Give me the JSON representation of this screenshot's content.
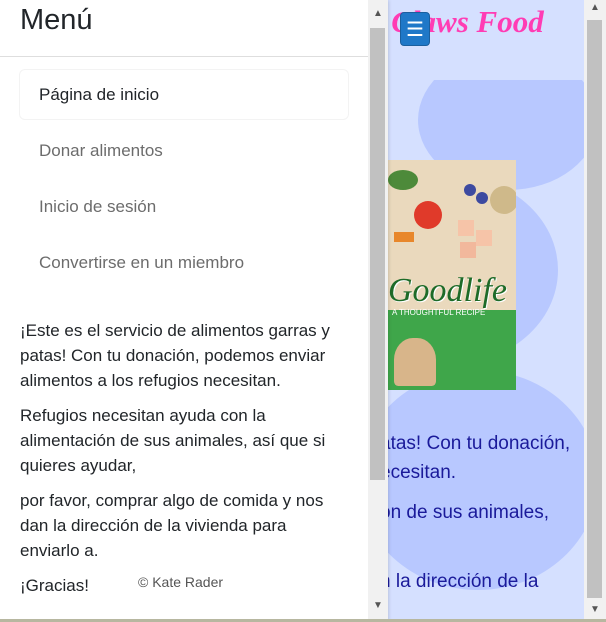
{
  "background_page": {
    "site_title": "d Claws Food",
    "toggle_icon": "☰",
    "product_logo": "Goodlife",
    "product_sub": "A THOUGHTFUL RECIPE",
    "text_lines": [
      "atas! Con tu donación,",
      "ecesitan.",
      "ón de sus animales,",
      "n la dirección de la"
    ],
    "colors": {
      "title": "#ff3cb4",
      "text": "#1a1a9a",
      "accent": "#1f78c8"
    }
  },
  "offcanvas": {
    "title": "Menú",
    "nav": [
      {
        "label": "Página de inicio",
        "active": true
      },
      {
        "label": "Donar alimentos",
        "active": false
      },
      {
        "label": "Inicio de sesión",
        "active": false
      },
      {
        "label": "Convertirse en un miembro",
        "active": false
      }
    ],
    "paragraphs": [
      "¡Este es el servicio de alimentos garras y patas! Con tu donación, podemos enviar alimentos a los refugios necesitan.",
      "Refugios necesitan ayuda con la alimentación de sus animales, así que si quieres ayudar,",
      "por favor, comprar algo de comida y nos dan la dirección de la vivienda para enviarlo a.",
      "¡Gracias!"
    ],
    "footer": "© Kate Rader"
  },
  "scrollbar": {
    "up_arrow": "▲",
    "down_arrow": "▼"
  }
}
